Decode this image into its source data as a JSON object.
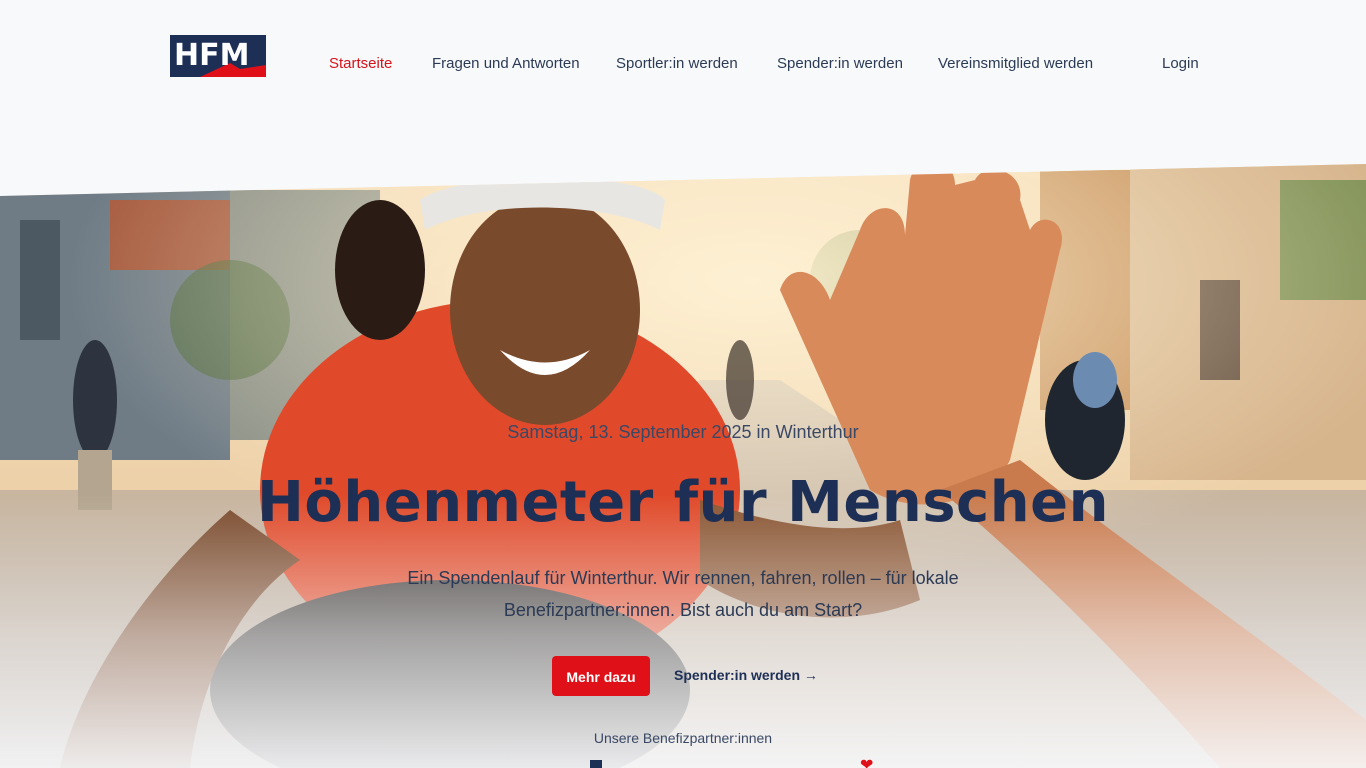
{
  "header": {
    "logo_text": "HFM",
    "nav": [
      {
        "label": "Startseite",
        "active": true
      },
      {
        "label": "Fragen und Antworten",
        "active": false
      },
      {
        "label": "Sportler:in werden",
        "active": false
      },
      {
        "label": "Spender:in werden",
        "active": false
      },
      {
        "label": "Vereinsmitglied werden",
        "active": false
      }
    ],
    "login_label": "Login"
  },
  "hero": {
    "date_line": "Samstag, 13. September 2025 in Winterthur",
    "headline": "Höhenmeter für Menschen",
    "lead": "Ein Spendenlauf für Winterthur. Wir rennen, fahren, rollen – für lokale Benefizpartner:innen. Bist auch du am Start?",
    "primary_button": "Mehr dazu",
    "secondary_link": "Spender:in werden →",
    "partners_label": "Unsere Benefizpartner:innen"
  },
  "colors": {
    "accent": "#e01018",
    "navy": "#1d2f55",
    "background": "#f8f9fb"
  }
}
